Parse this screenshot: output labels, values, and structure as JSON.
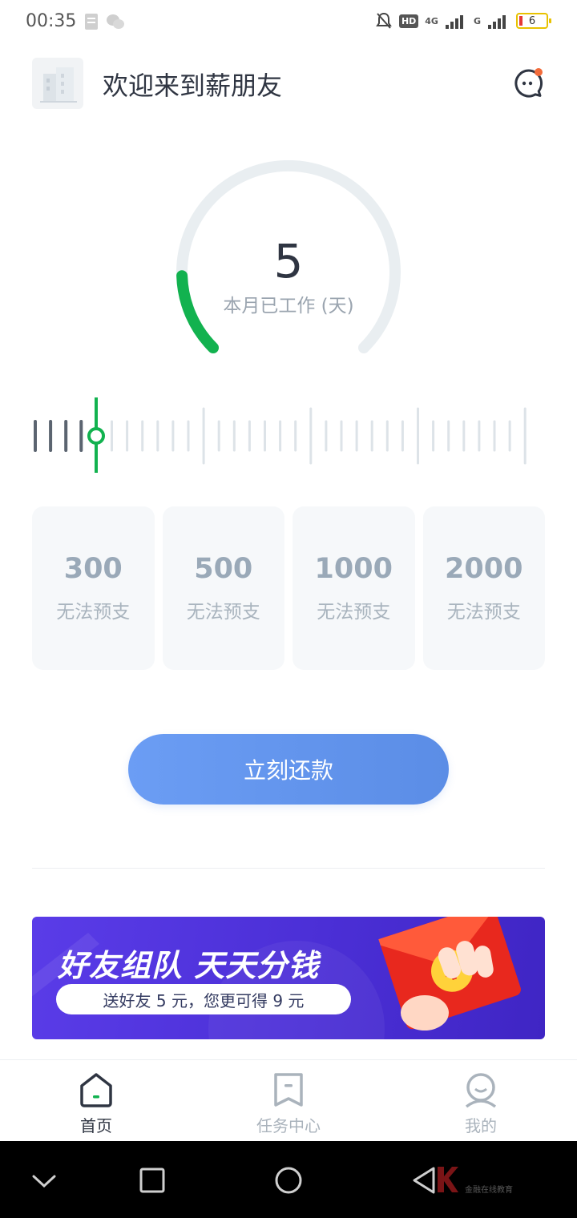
{
  "status_bar": {
    "time": "00:35",
    "hd": "HD",
    "network": "4G",
    "network2": "G",
    "battery": "6"
  },
  "header": {
    "title": "欢迎来到薪朋友",
    "notification_dot_color": "#f26b3a"
  },
  "work_days": {
    "value": "5",
    "label": "本月已工作 (天)",
    "progress_fraction": 0.16,
    "accent_color": "#12b24f"
  },
  "amount_cards": [
    {
      "amount": "300",
      "status": "无法预支"
    },
    {
      "amount": "500",
      "status": "无法预支"
    },
    {
      "amount": "1000",
      "status": "无法预支"
    },
    {
      "amount": "2000",
      "status": "无法预支"
    }
  ],
  "repay_button": {
    "label": "立刻还款"
  },
  "banner": {
    "title": "好友组队 天天分钱",
    "subtitle": "送好友 5 元，您更可得 9 元"
  },
  "tabbar": {
    "tabs": [
      {
        "label": "首页",
        "icon": "home-icon"
      },
      {
        "label": "任务中心",
        "icon": "bookmark-icon"
      },
      {
        "label": "我的",
        "icon": "user-icon"
      }
    ]
  },
  "navbar": {
    "watermark": "金融在线教育"
  }
}
